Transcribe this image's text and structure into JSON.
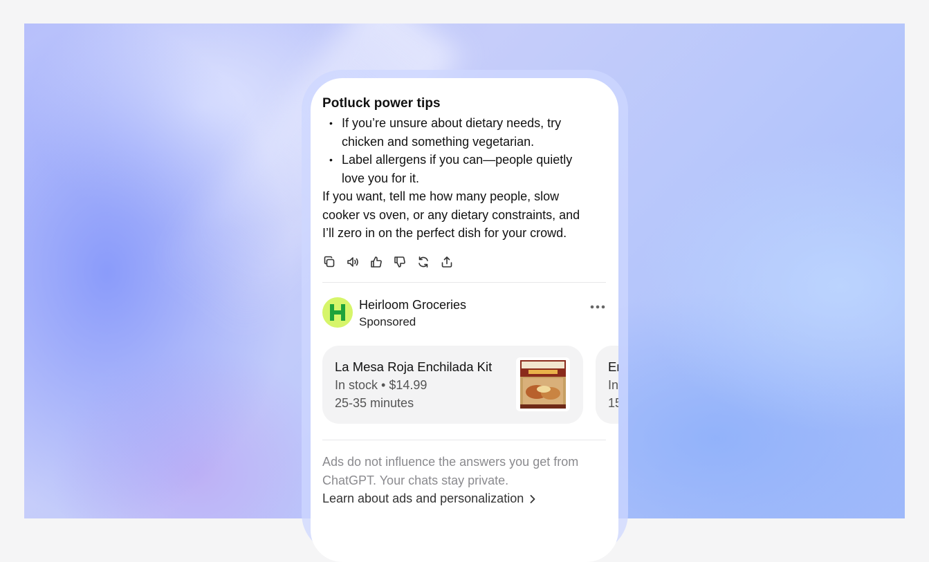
{
  "message": {
    "heading": "Potluck power tips",
    "bullets": [
      {
        "line1": "If you’re unsure about dietary needs, try",
        "line2": "chicken and something vegetarian."
      },
      {
        "line1": "Label allergens if you can—people quietly",
        "line2": "love you for it."
      }
    ],
    "paragraph": "If you want, tell me how many people, slow cooker vs oven, or any dietary constraints, and I’ll zero in on the perfect dish for your crowd."
  },
  "actions": [
    {
      "name": "copy-icon"
    },
    {
      "name": "read-aloud-icon"
    },
    {
      "name": "thumbs-up-icon"
    },
    {
      "name": "thumbs-down-icon"
    },
    {
      "name": "regenerate-icon"
    },
    {
      "name": "share-icon"
    }
  ],
  "ad": {
    "brand": "Heirloom Groceries",
    "sponsored": "Sponsored",
    "logo_letter": "H",
    "logo_color": "#d6f56a",
    "logo_letter_color": "#1fa33b",
    "products": [
      {
        "title": "La Mesa Roja Enchilada Kit",
        "stock": "In stock • $14.99",
        "time": "25-35 minutes"
      },
      {
        "title": "En",
        "stock": "In",
        "time": "15"
      }
    ]
  },
  "disclaimer": {
    "text_line1": "Ads do not influence the answers you get from",
    "text_line2": "ChatGPT. Your chats stay private.",
    "link": "Learn about ads and personalization"
  }
}
